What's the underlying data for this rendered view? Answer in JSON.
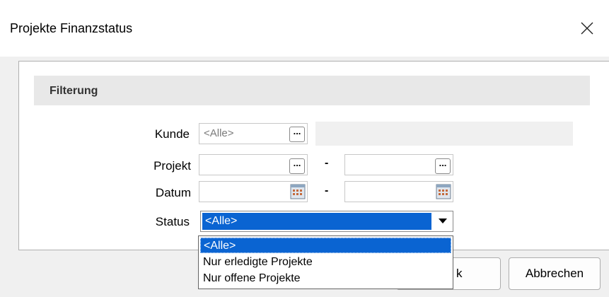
{
  "window": {
    "title": "Projekte Finanzstatus",
    "close_glyph": "✕"
  },
  "section": {
    "title": "Filterung"
  },
  "form": {
    "kunde": {
      "label": "Kunde",
      "placeholder": "<Alle>",
      "button": "..."
    },
    "projekt": {
      "label": "Projekt",
      "from_value": "",
      "to_value": "",
      "button": "...",
      "separator": "-"
    },
    "datum": {
      "label": "Datum",
      "from_value": "",
      "to_value": "",
      "separator": "-"
    },
    "status": {
      "label": "Status",
      "selected": "<Alle>"
    }
  },
  "dropdown": {
    "options": [
      "<Alle>",
      "Nur erledigte Projekte",
      "Nur offene Projekte"
    ]
  },
  "buttons": {
    "ok_visible_fragment": "k",
    "cancel": "Abbrechen"
  },
  "colors": {
    "selection": "#0a64d2",
    "panel_header": "#e8e8e8"
  }
}
